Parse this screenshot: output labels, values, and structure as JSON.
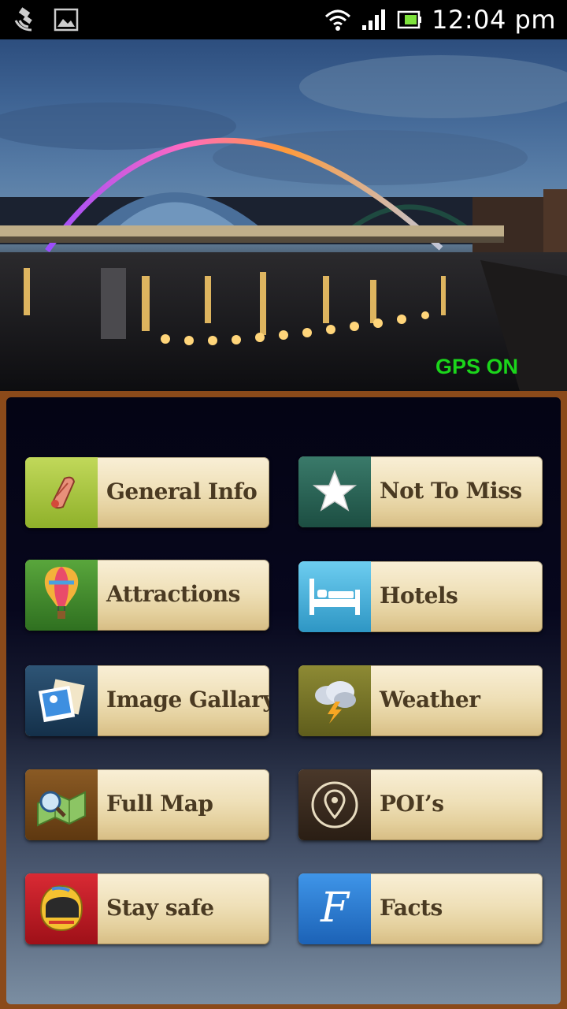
{
  "status_bar": {
    "time": "12:04 pm"
  },
  "hero": {
    "gps_status": "GPS ON"
  },
  "menu": {
    "items": [
      {
        "label": "General Info",
        "icon": "scroll-map-icon",
        "color": "#a6c43a"
      },
      {
        "label": "Not To Miss",
        "icon": "star-icon",
        "color": "#2c6658"
      },
      {
        "label": "Attractions",
        "icon": "hot-air-balloon-icon",
        "color": "#3f8d2c"
      },
      {
        "label": "Hotels",
        "icon": "bed-icon",
        "color": "#4fb8e0"
      },
      {
        "label": "Image Gallary",
        "icon": "photos-icon",
        "color": "#1f3f5e"
      },
      {
        "label": "Weather",
        "icon": "storm-cloud-icon",
        "color": "#7e7c2a"
      },
      {
        "label": "Full Map",
        "icon": "map-magnifier-icon",
        "color": "#7a4a1c"
      },
      {
        "label": "POI’s",
        "icon": "location-pin-icon",
        "color": "#3a2a1e"
      },
      {
        "label": "Stay safe",
        "icon": "helmet-icon",
        "color": "#c6202a"
      },
      {
        "label": "Facts",
        "icon": "letter-f-icon",
        "color": "#2d7fd3"
      }
    ]
  }
}
